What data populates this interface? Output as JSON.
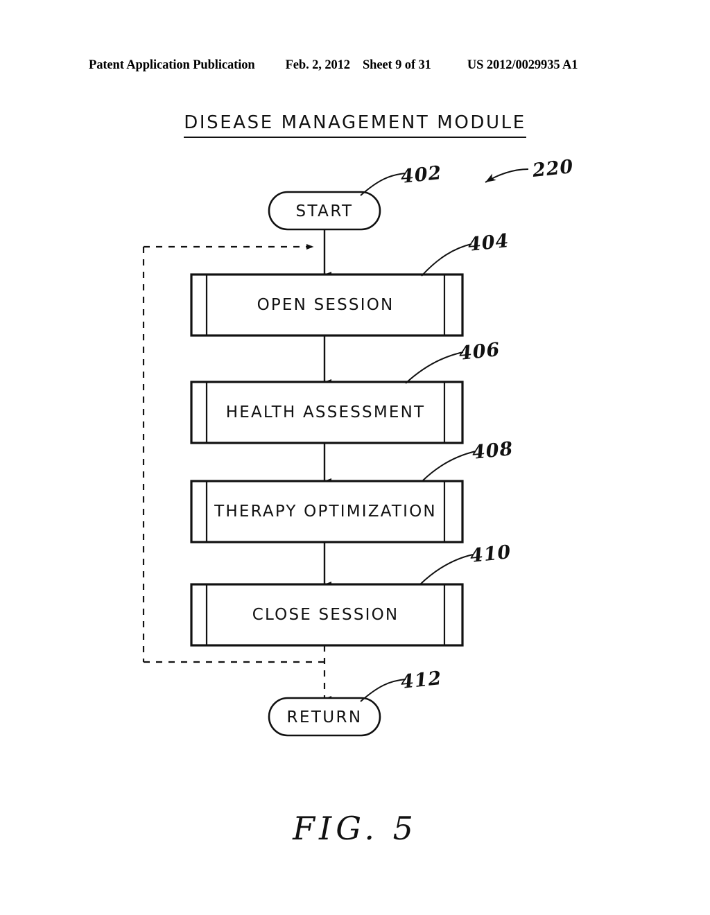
{
  "header": {
    "publication": "Patent Application Publication",
    "date": "Feb. 2, 2012",
    "sheet": "Sheet 9 of 31",
    "patent_number": "US 2012/0029935 A1"
  },
  "figure": {
    "title": "DISEASE MANAGEMENT MODULE",
    "caption": "FIG. 5",
    "module_ref": "220"
  },
  "flowchart": {
    "type": "flowchart",
    "nodes": [
      {
        "id": "start",
        "label": "START",
        "ref": "402",
        "shape": "terminal"
      },
      {
        "id": "open",
        "label": "OPEN SESSION",
        "ref": "404",
        "shape": "predefined-process"
      },
      {
        "id": "health",
        "label": "HEALTH ASSESSMENT",
        "ref": "406",
        "shape": "predefined-process"
      },
      {
        "id": "therapy",
        "label": "THERAPY OPTIMIZATION",
        "ref": "408",
        "shape": "predefined-process"
      },
      {
        "id": "close",
        "label": "CLOSE SESSION",
        "ref": "410",
        "shape": "predefined-process"
      },
      {
        "id": "return",
        "label": "RETURN",
        "ref": "412",
        "shape": "terminal"
      }
    ],
    "edges": [
      {
        "from": "start",
        "to": "open",
        "style": "solid"
      },
      {
        "from": "open",
        "to": "health",
        "style": "solid"
      },
      {
        "from": "health",
        "to": "therapy",
        "style": "solid"
      },
      {
        "from": "therapy",
        "to": "close",
        "style": "solid"
      },
      {
        "from": "close",
        "to": "return",
        "style": "dashed"
      },
      {
        "from": "close",
        "to": "open",
        "style": "dashed",
        "kind": "feedback-loop"
      }
    ]
  },
  "colors": {
    "ink": "#111111",
    "paper": "#ffffff"
  }
}
